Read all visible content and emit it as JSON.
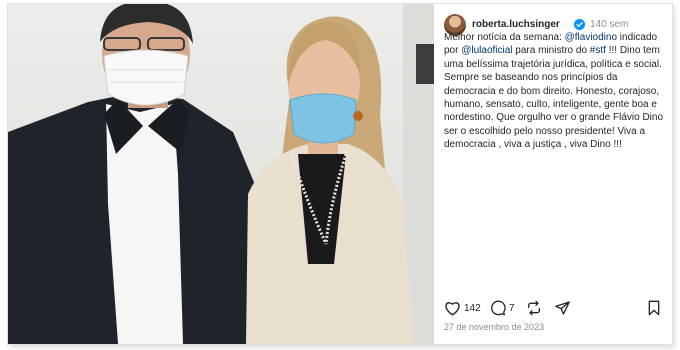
{
  "post": {
    "username": "roberta.luchsinger",
    "time_ago": "140 sem",
    "caption": {
      "intro": "Melhor notícia da semana: ",
      "mention1": "@flaviodino",
      "text2": " indicado por ",
      "mention2": "@lulaoficial",
      "text3": " para ministro do ",
      "hashtag": "#stf",
      "text4": " !!! Dino tem uma belíssima trajetória jurídica, política e social. Sempre se baseando nos princípios da democracia e do bom direito. Honesto, corajoso, humano, sensato, culto, inteligente, gente boa e nordestino. Que orgulho ver o grande Flávio Dino ser o escolhido pelo nosso presidente! Viva a democracia , viva a justiça , viva Dino !!!"
    },
    "likes": "142",
    "comments": "7",
    "date": "27 de novembro de 2023"
  },
  "icons": {
    "verified": "verified-badge-icon",
    "like": "heart-icon",
    "comment": "comment-icon",
    "share": "repost-icon",
    "send": "send-icon",
    "save": "bookmark-icon"
  },
  "colors": {
    "link": "#00376b",
    "verified": "#0095f6",
    "text": "#262626",
    "muted": "#8e8e8e"
  }
}
